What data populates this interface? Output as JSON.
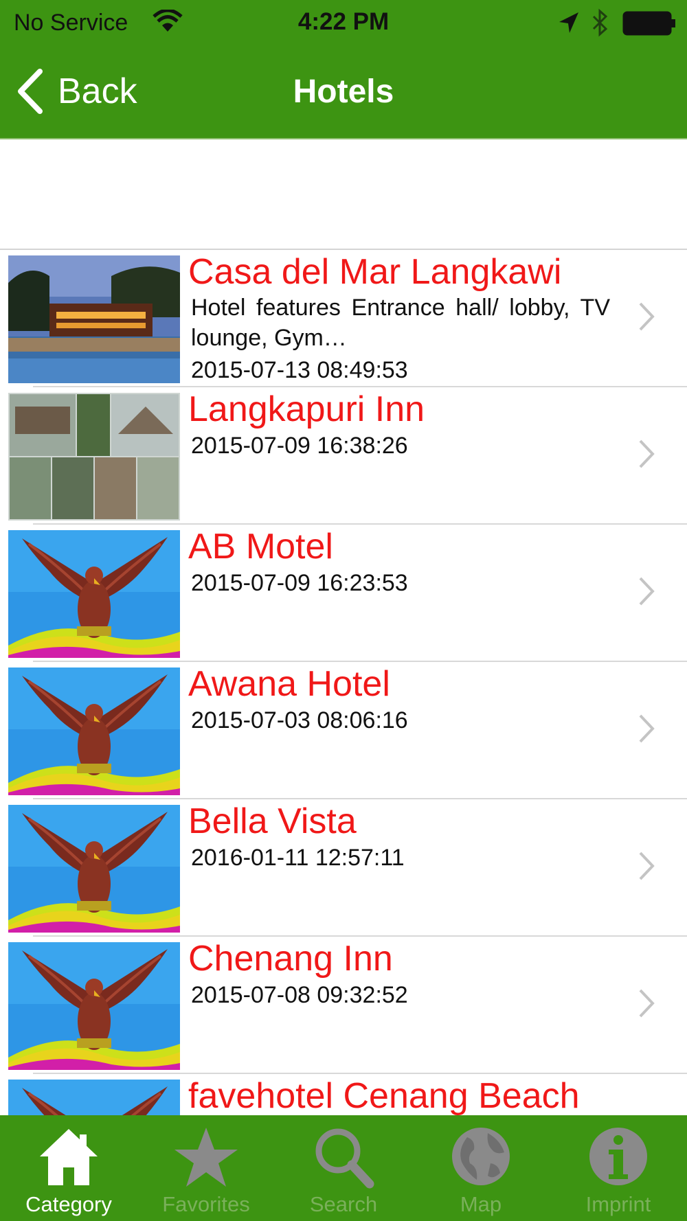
{
  "status_bar": {
    "carrier": "No Service",
    "time": "4:22 PM",
    "icons": [
      "wifi-icon",
      "location-arrow-icon",
      "bluetooth-icon",
      "battery-icon"
    ]
  },
  "nav": {
    "back_label": "Back",
    "title": "Hotels"
  },
  "colors": {
    "bar_green": "#3d9412",
    "title_red": "#f01818",
    "inactive_tab": "#7ab05a"
  },
  "hotels": [
    {
      "name": "Casa del Mar Langkawi",
      "description": "Hotel features Entrance hall/ lobby, TV lounge, Gym…",
      "date": "2015-07-13 08:49:53",
      "thumb": "resort-pool-photo"
    },
    {
      "name": "Langkapuri Inn",
      "date": "2015-07-09 16:38:26",
      "thumb": "inn-collage-photo"
    },
    {
      "name": "AB Motel",
      "date": "2015-07-09 16:23:53",
      "thumb": "eagle-statue-placeholder"
    },
    {
      "name": "Awana Hotel",
      "date": "2015-07-03 08:06:16",
      "thumb": "eagle-statue-placeholder"
    },
    {
      "name": "Bella Vista",
      "date": "2016-01-11 12:57:11",
      "thumb": "eagle-statue-placeholder"
    },
    {
      "name": "Chenang Inn",
      "date": "2015-07-08 09:32:52",
      "thumb": "eagle-statue-placeholder"
    },
    {
      "name": "favehotel Cenang Beach",
      "date": "",
      "thumb": "eagle-statue-placeholder"
    }
  ],
  "tabs": [
    {
      "label": "Category",
      "icon": "home-icon",
      "active": true
    },
    {
      "label": "Favorites",
      "icon": "star-icon",
      "active": false
    },
    {
      "label": "Search",
      "icon": "search-icon",
      "active": false
    },
    {
      "label": "Map",
      "icon": "globe-icon",
      "active": false
    },
    {
      "label": "Imprint",
      "icon": "info-icon",
      "active": false
    }
  ]
}
